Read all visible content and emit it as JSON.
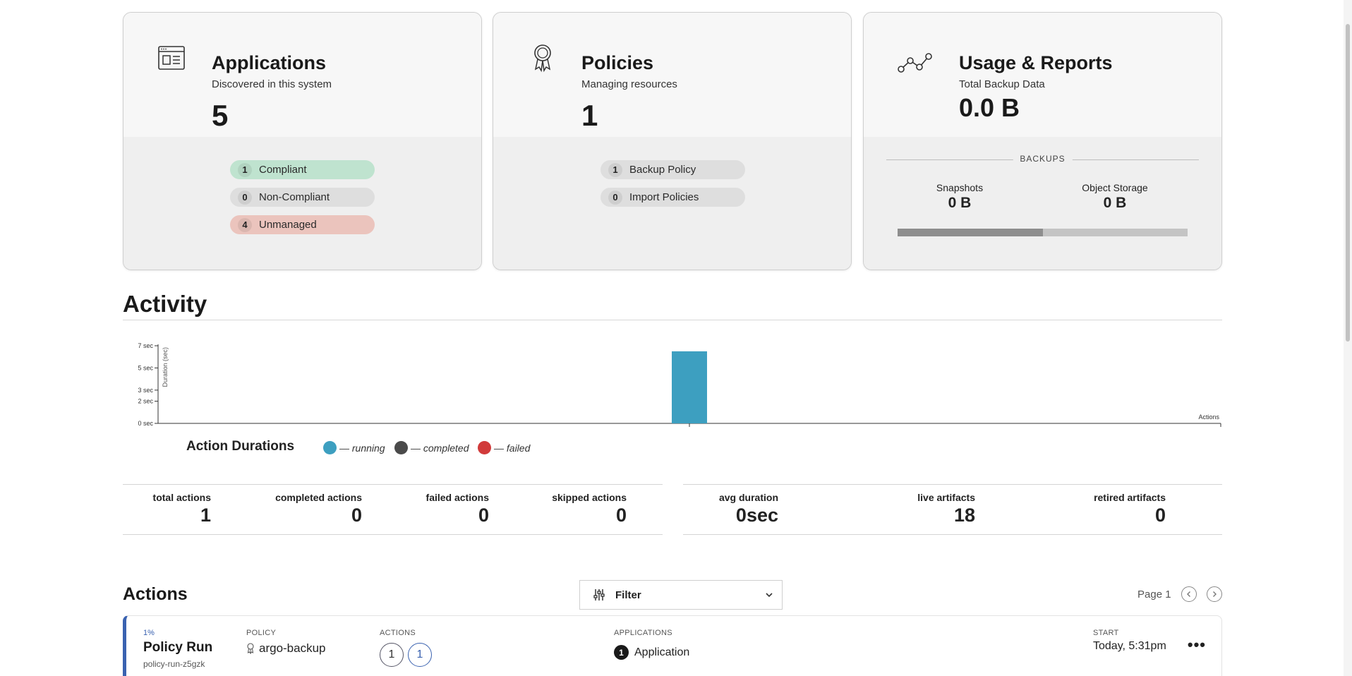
{
  "applications": {
    "title": "Applications",
    "subtitle": "Discovered in this system",
    "count": "5",
    "pills": [
      {
        "count": "1",
        "label": "Compliant"
      },
      {
        "count": "0",
        "label": "Non-Compliant"
      },
      {
        "count": "4",
        "label": "Unmanaged"
      }
    ]
  },
  "policies": {
    "title": "Policies",
    "subtitle": "Managing resources",
    "count": "1",
    "pills": [
      {
        "count": "1",
        "label": "Backup Policy"
      },
      {
        "count": "0",
        "label": "Import Policies"
      }
    ]
  },
  "usage": {
    "title": "Usage & Reports",
    "subtitle": "Total Backup Data",
    "total": "0.0 B",
    "backups_label": "BACKUPS",
    "snapshots_label": "Snapshots",
    "snapshots_value": "0 B",
    "object_storage_label": "Object Storage",
    "object_storage_value": "0 B",
    "snapshot_share": 0.5
  },
  "activity": {
    "title": "Activity"
  },
  "chart_data": {
    "type": "bar",
    "title": "Action Durations",
    "ylabel": "Duration (sec)",
    "xlabel": "Actions",
    "yticks": [
      "0 sec",
      "2 sec",
      "3 sec",
      "5 sec",
      "7 sec"
    ],
    "ylim": [
      0,
      7
    ],
    "series": [
      {
        "name": "running",
        "color": "#3d9fc0",
        "values": [
          6.5
        ]
      }
    ],
    "legend": [
      {
        "label": "— running",
        "color": "#3d9fc0"
      },
      {
        "label": "— completed",
        "color": "#4a4a4a"
      },
      {
        "label": "— failed",
        "color": "#d13b3b"
      }
    ],
    "grid": false
  },
  "action_stats": {
    "total_label": "total actions",
    "total_value": "1",
    "completed_label": "completed actions",
    "completed_value": "0",
    "failed_label": "failed actions",
    "failed_value": "0",
    "skipped_label": "skipped actions",
    "skipped_value": "0"
  },
  "artifact_stats": {
    "avg_label": "avg duration",
    "avg_value": "0sec",
    "live_label": "live artifacts",
    "live_value": "18",
    "retired_label": "retired artifacts",
    "retired_value": "0"
  },
  "actions": {
    "title": "Actions",
    "filter_label": "Filter",
    "page_label": "Page 1",
    "rows": [
      {
        "percent": "1%",
        "type": "Policy Run",
        "id": "policy-run-z5gzk",
        "policy_caption": "POLICY",
        "policy": "argo-backup",
        "actions_caption": "ACTIONS",
        "actions_a": "1",
        "actions_b": "1",
        "applications_caption": "APPLICATIONS",
        "applications_count": "1",
        "applications_label": "Application",
        "start_caption": "START",
        "start": "Today, 5:31pm",
        "more": "•••"
      }
    ]
  },
  "icons": {
    "applications": "application-window-icon",
    "policies": "award-ribbon-icon",
    "usage": "line-graph-icon",
    "filter": "sliders-icon",
    "dropdown": "chevron-down-icon",
    "prev": "chevron-left-icon",
    "next": "chevron-right-icon",
    "policy": "award-ribbon-icon"
  }
}
